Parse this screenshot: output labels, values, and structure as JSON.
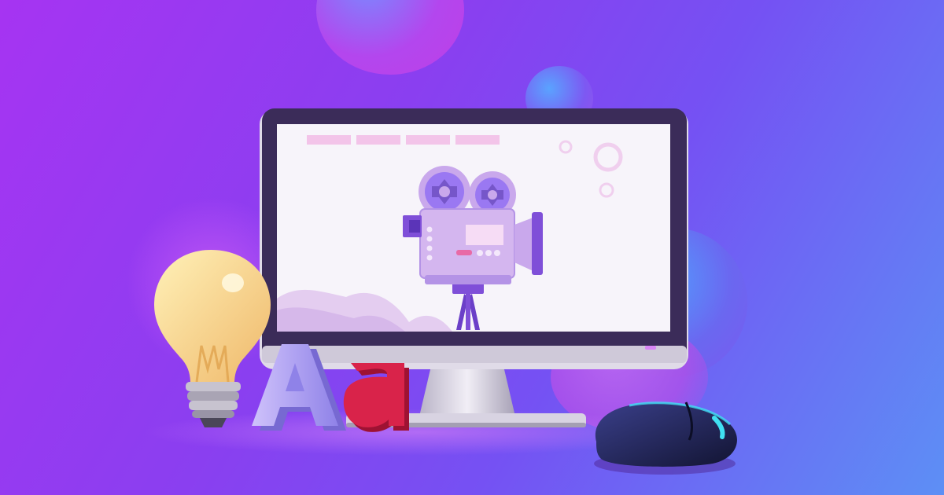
{
  "colors": {
    "bg_left": "#a634f2",
    "bg_mid": "#7551f3",
    "bg_right": "#5d8ff5",
    "monitor_frame": "#3b2c59",
    "screen": "#f7f4fa",
    "camera_body": "#c9a8ec",
    "camera_reel": "#9a78f2",
    "letter_A": "#b8a4f6",
    "letter_a": "#d9234a",
    "bulb_glass": "#f7d98a",
    "mouse": "#1c1f4d",
    "mouse_accent": "#40e0f2",
    "power_led": "#d986f5"
  },
  "icons": {
    "camera": "movie-camera-icon",
    "bulb": "light-bulb-icon",
    "mouse": "computer-mouse-icon",
    "letters": "font-letters-icon"
  },
  "letters": {
    "uppercase": "A",
    "lowercase": "a"
  }
}
